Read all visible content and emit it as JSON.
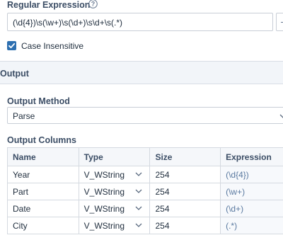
{
  "regex": {
    "label": "Regular Expression",
    "value": "(\\d{4})\\s(\\w+)\\s(\\d+)\\s\\d+\\s(.*)"
  },
  "case_insensitive": {
    "label": "Case Insensitive",
    "checked": true
  },
  "output": {
    "title": "Output",
    "method_label": "Output Method",
    "method_value": "Parse",
    "columns_label": "Output Columns",
    "headers": [
      "Name",
      "Type",
      "Size",
      "Expression"
    ],
    "rows": [
      {
        "name": "Year",
        "type": "V_WString",
        "size": "254",
        "expression": "(\\d{4})"
      },
      {
        "name": "Part",
        "type": "V_WString",
        "size": "254",
        "expression": "(\\w+)"
      },
      {
        "name": "Date",
        "type": "V_WString",
        "size": "254",
        "expression": "(\\d+)"
      },
      {
        "name": "City",
        "type": "V_WString",
        "size": "254",
        "expression": "(.*)"
      }
    ]
  },
  "colors": {
    "accent": "#2d6fb0",
    "label": "#3b4d65",
    "expression_text": "#5b7aa0"
  },
  "icons": [
    "help-icon",
    "check-icon",
    "chevron-down-icon"
  ]
}
